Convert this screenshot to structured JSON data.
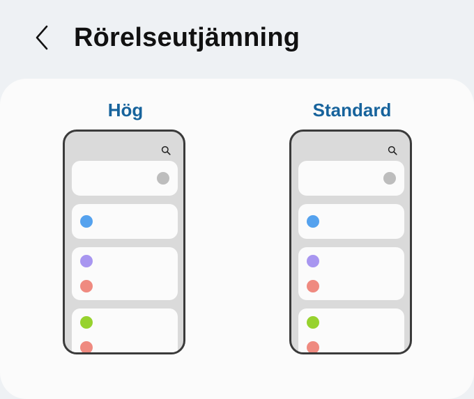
{
  "header": {
    "title": "Rörelseutjämning",
    "back_icon": "chevron-left-icon"
  },
  "options": [
    {
      "label": "Hög"
    },
    {
      "label": "Standard"
    }
  ],
  "preview": {
    "search_icon": "search-icon",
    "colors": {
      "toggle": "#bdbdbd",
      "blue": "#55a2ee",
      "purple": "#a896f0",
      "red": "#ef8a80",
      "green": "#97d22e",
      "phone_bg": "#dadada",
      "phone_border": "#3a3a3a"
    }
  },
  "colors": {
    "page_bg": "#eef1f4",
    "card_bg": "#fbfbfb",
    "accent": "#17639c",
    "title": "#111111"
  }
}
